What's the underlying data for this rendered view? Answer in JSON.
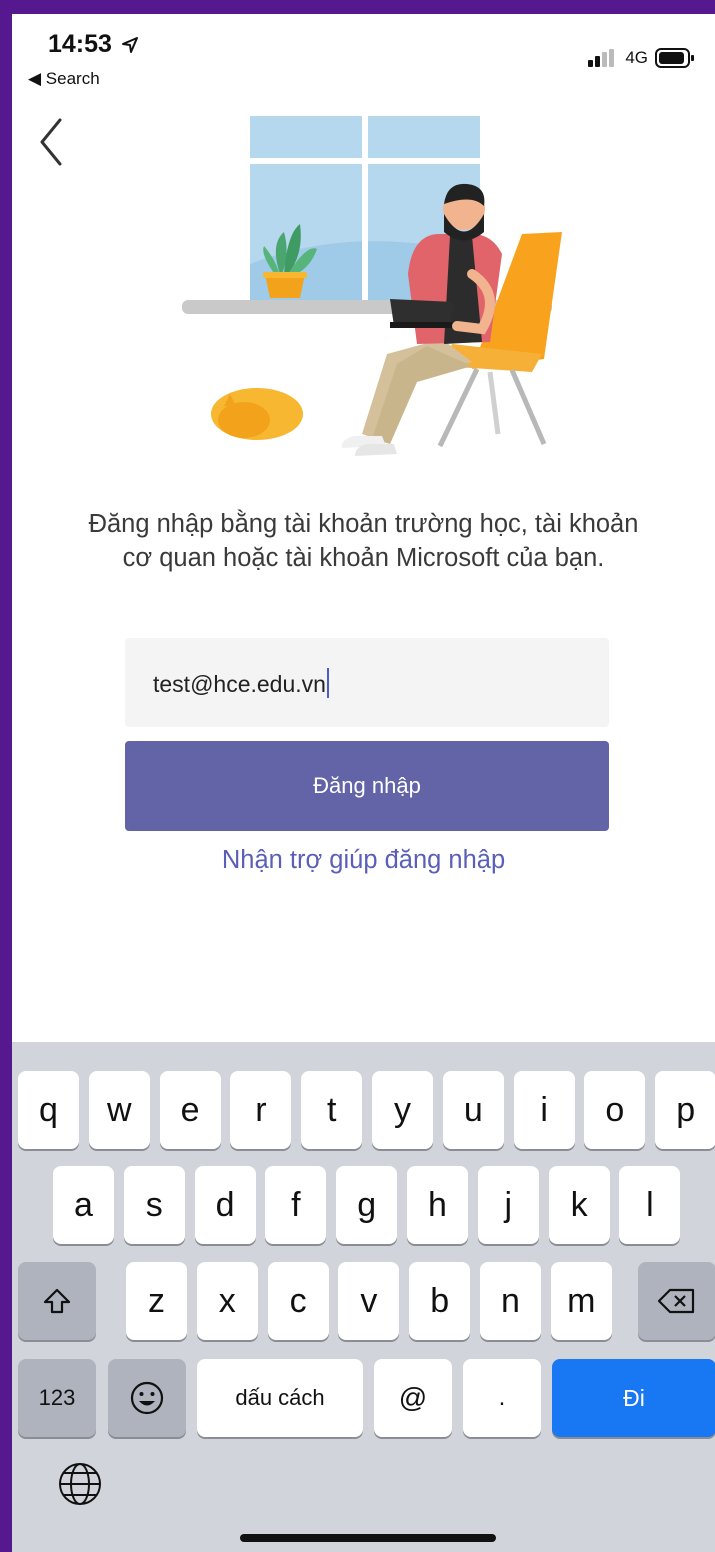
{
  "status_bar": {
    "time": "14:53",
    "back_label": "◀ Search",
    "network": "4G"
  },
  "login": {
    "prompt": "Đăng nhập bằng tài khoản trường học, tài khoản cơ quan hoặc tài khoản Microsoft của bạn.",
    "email_value": "test@hce.edu.vn",
    "signin_label": "Đăng nhập",
    "help_link": "Nhận trợ giúp đăng nhập"
  },
  "keyboard": {
    "row1": [
      "q",
      "w",
      "e",
      "r",
      "t",
      "y",
      "u",
      "i",
      "o",
      "p"
    ],
    "row2": [
      "a",
      "s",
      "d",
      "f",
      "g",
      "h",
      "j",
      "k",
      "l"
    ],
    "row3": [
      "z",
      "x",
      "c",
      "v",
      "b",
      "n",
      "m"
    ],
    "numbers_label": "123",
    "space_label": "dấu cách",
    "at_label": "@",
    "dot_label": ".",
    "go_label": "Đi",
    "shift_icon": "shift-icon",
    "delete_icon": "delete-icon",
    "emoji_icon": "emoji-icon",
    "globe_icon": "globe-icon"
  },
  "colors": {
    "frame": "#56188f",
    "button": "#6264a7",
    "link": "#5b5fb6",
    "go_key": "#1877f2"
  }
}
